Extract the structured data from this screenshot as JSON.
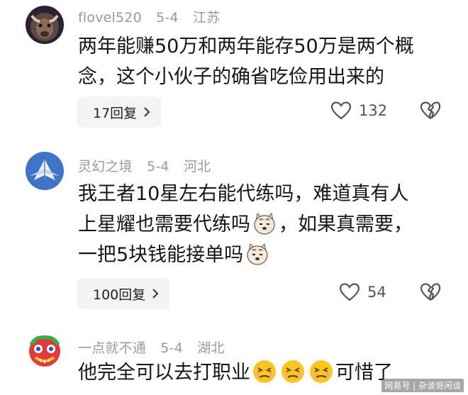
{
  "comments": [
    {
      "username": "flovel520",
      "date": "5-4",
      "location": "江苏",
      "text_lines": [
        "两年能赚50万和两年能存50万是两个概",
        "念，这个小伙子的确省吃俭用出来的"
      ],
      "reply_label": "17回复",
      "likes": "132",
      "avatar_icon": "bull-avatar-icon"
    },
    {
      "username": "灵幻之境",
      "date": "5-4",
      "location": "河北",
      "text_parts": {
        "line1": "我王者10星左右能代练吗，难道真有人",
        "line2a": "上星耀也需要代练吗",
        "line2b": "，如果真需要，",
        "line3": "一把5块钱能接单吗"
      },
      "reply_label": "100回复",
      "likes": "54",
      "avatar_icon": "jet-avatar-icon"
    },
    {
      "username": "一点就不通",
      "date": "5-4",
      "location": "湖北",
      "text_part": "他完全可以去打职业",
      "text_end": "可惜了",
      "avatar_icon": "lion-dance-avatar-icon"
    }
  ],
  "watermark": "网易号 | 杂谈哥闲谈",
  "colors": {
    "meta": "#9a9a9a",
    "reply_bg": "#f3f3f3"
  }
}
